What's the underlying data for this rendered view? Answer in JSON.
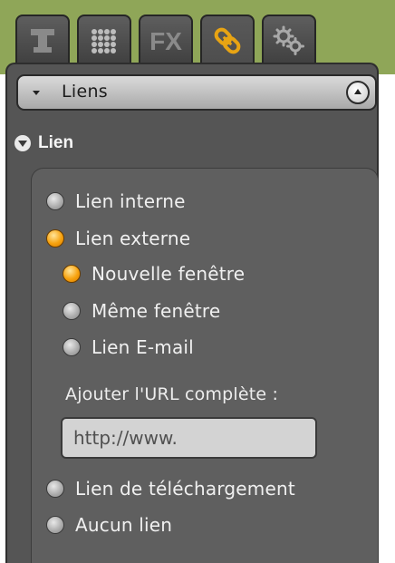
{
  "tabs": [
    {
      "name": "text",
      "icon": "text-icon"
    },
    {
      "name": "grid",
      "icon": "grid-dots-icon"
    },
    {
      "name": "effects",
      "icon": "fx-icon",
      "label": "FX"
    },
    {
      "name": "links",
      "icon": "chain-link-icon",
      "active": true
    },
    {
      "name": "settings",
      "icon": "gears-icon"
    }
  ],
  "section": {
    "title": "Liens"
  },
  "group": {
    "title": "Lien"
  },
  "link_options": [
    {
      "label": "Lien interne",
      "checked": false
    },
    {
      "label": "Lien externe",
      "checked": true
    }
  ],
  "external_options": [
    {
      "label": "Nouvelle fenêtre",
      "checked": true
    },
    {
      "label": "Même fenêtre",
      "checked": false
    },
    {
      "label": "Lien E-mail",
      "checked": false
    }
  ],
  "url": {
    "label": "Ajouter l'URL complète :",
    "value": "http://www."
  },
  "other_options": [
    {
      "label": "Lien de téléchargement",
      "checked": false
    },
    {
      "label": "Aucun lien",
      "checked": false
    }
  ],
  "colors": {
    "accent": "#f7a20e",
    "panel": "#555555",
    "background_top": "#8fa658"
  }
}
